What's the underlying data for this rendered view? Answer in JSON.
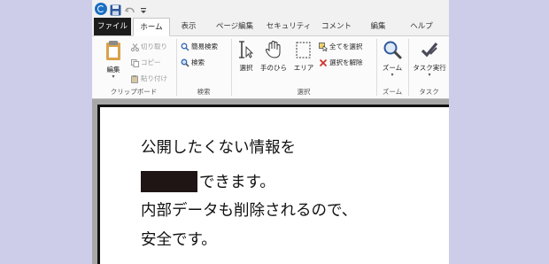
{
  "tabs": {
    "file": "ファイル",
    "home": "ホーム",
    "view": "表示",
    "page_edit": "ページ編集",
    "security": "セキュリティ",
    "comment": "コメント",
    "edit": "編集",
    "help": "ヘルプ"
  },
  "ribbon": {
    "clipboard": {
      "label": "クリップボード",
      "edit": "編集",
      "cut": "切り取り",
      "copy": "コピー",
      "paste": "貼り付け"
    },
    "search": {
      "label": "検索",
      "simple_search": "簡易検索",
      "search": "検索"
    },
    "select": {
      "label": "選択",
      "select": "選択",
      "hand": "手のひら",
      "area": "エリア",
      "select_all": "全てを選択",
      "deselect": "選択を解除"
    },
    "zoom": {
      "label": "ズーム",
      "zoom": "ズーム"
    },
    "task": {
      "label": "タスク",
      "run_task": "タスク実行"
    }
  },
  "document": {
    "line1": "公開したくない情報を",
    "line2_suffix": "できます。",
    "line3": "内部データも削除されるので、",
    "line4": "安全です。"
  },
  "colors": {
    "background": "#cdcde9",
    "file_tab": "#1c1c1c",
    "redaction": "#201515",
    "accent": "#1a6fc2"
  }
}
